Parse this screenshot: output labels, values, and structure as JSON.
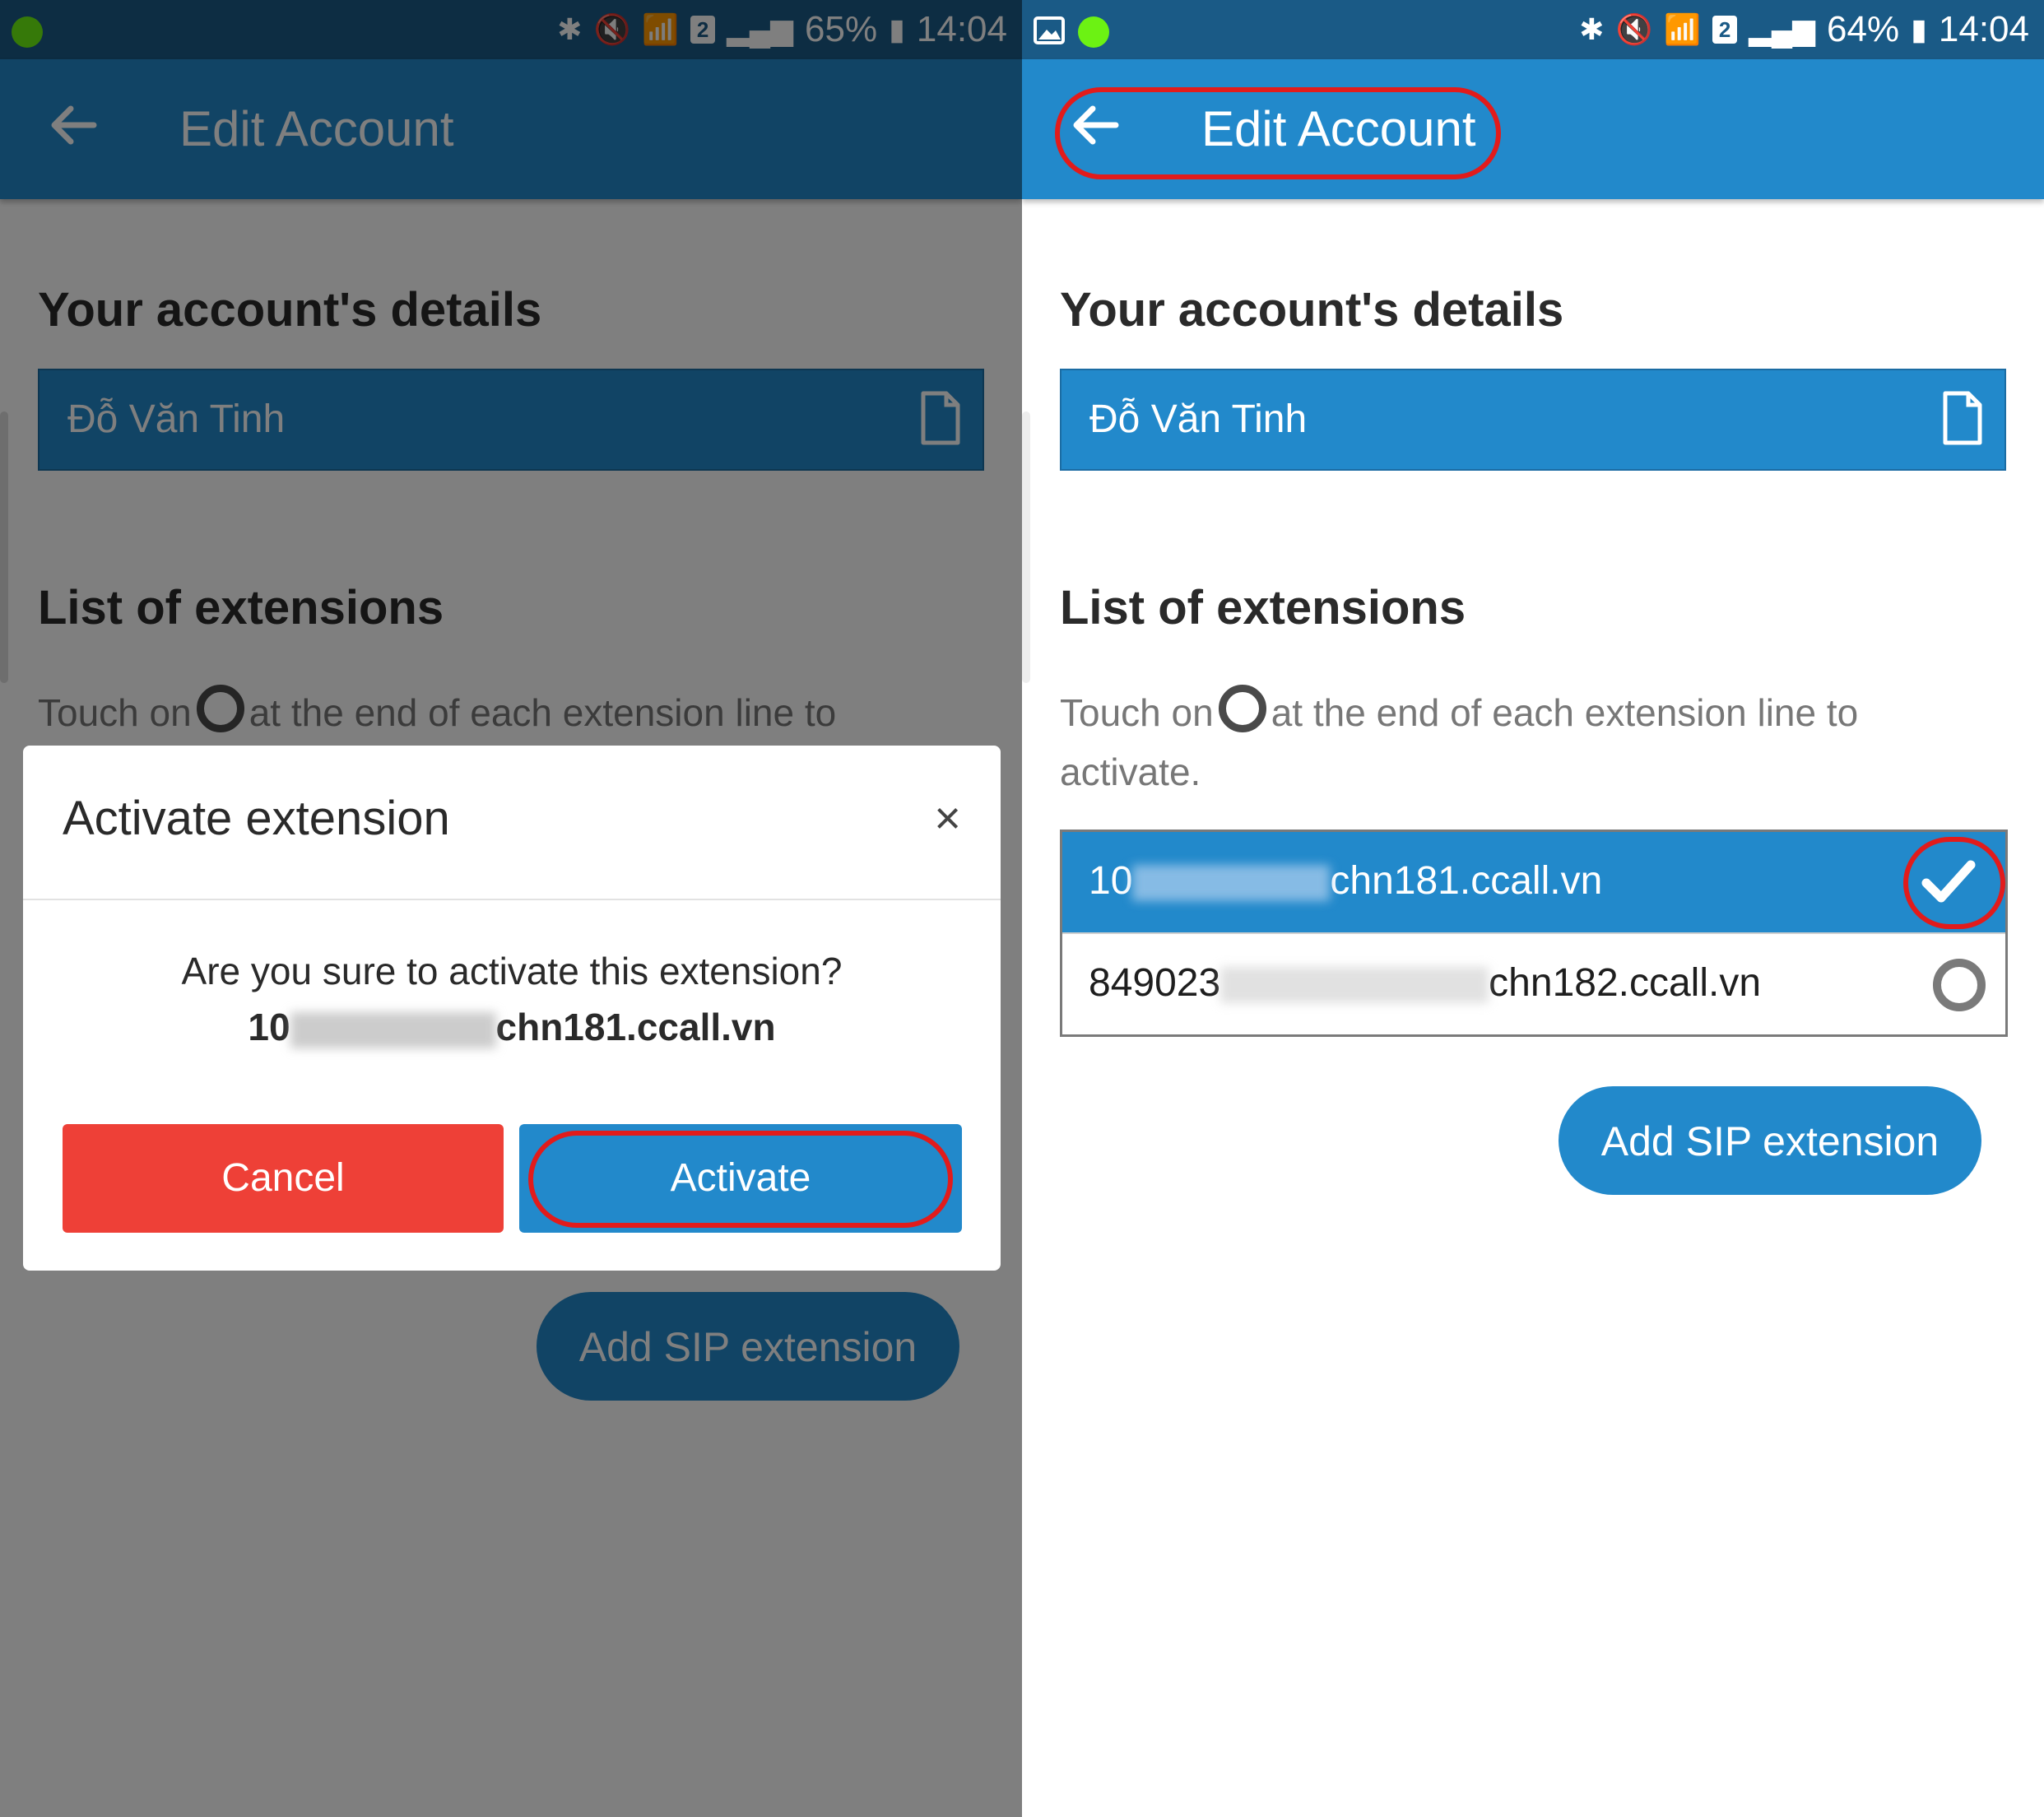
{
  "left": {
    "status": {
      "battery": "65%",
      "time": "14:04",
      "sim_badge": "2"
    },
    "appbar": {
      "title": "Edit Account"
    },
    "details_heading": "Your account's details",
    "account_name": "Đỗ Văn Tinh",
    "extensions_heading": "List of extensions",
    "hint_before": "Touch on",
    "hint_after": "at the end of each extension line to",
    "add_sip_label": "Add SIP extension",
    "dialog": {
      "title": "Activate extension",
      "close_glyph": "×",
      "question": "Are you sure to activate this extension?",
      "ext_prefix": "10",
      "ext_suffix": "chn181.ccall.vn",
      "cancel_label": "Cancel",
      "activate_label": "Activate"
    }
  },
  "right": {
    "status": {
      "battery": "64%",
      "time": "14:04",
      "sim_badge": "2"
    },
    "appbar": {
      "title": "Edit Account"
    },
    "details_heading": "Your account's details",
    "account_name": "Đỗ Văn Tinh",
    "extensions_heading": "List of extensions",
    "hint_before": "Touch on",
    "hint_after": "at the end of each extension line to",
    "hint_line2": "activate.",
    "extensions": [
      {
        "prefix": "10",
        "suffix": "chn181.ccall.vn",
        "active": true
      },
      {
        "prefix": "849023",
        "suffix": "chn182.ccall.vn",
        "active": false
      }
    ],
    "add_sip_label": "Add SIP extension"
  },
  "colors": {
    "status_bar": "#1a5a86",
    "app_bar": "#2289cb",
    "cancel": "#ee4037",
    "highlight": "#e21b1b",
    "notification_dot": "#6cf213"
  },
  "icons": [
    "back-arrow-icon",
    "document-icon",
    "checkmark-icon",
    "radio-unselected-icon",
    "close-icon",
    "bluetooth-icon",
    "mute-icon",
    "wifi-icon",
    "signal-icon",
    "battery-icon",
    "gallery-icon"
  ]
}
